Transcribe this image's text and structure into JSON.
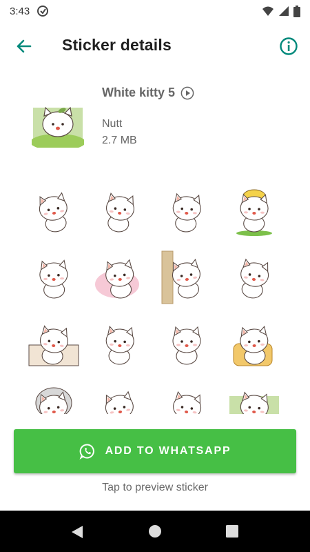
{
  "status_bar": {
    "time": "3:43",
    "icons": [
      "sync-icon",
      "wifi-icon",
      "signal-icon",
      "battery-icon"
    ]
  },
  "app_bar": {
    "title": "Sticker details",
    "back_icon": "arrow-left-icon",
    "info_icon": "info-icon"
  },
  "pack": {
    "name": "White kitty 5",
    "author": "Nutt",
    "size": "2.7 MB"
  },
  "stickers": [
    "sticker-cat-cheering",
    "sticker-cat-surprised",
    "sticker-cat-eating",
    "sticker-cat-yellow-hat",
    "sticker-cat-drinking",
    "sticker-cat-popcorn",
    "sticker-cat-peeking-wall",
    "sticker-cat-shy",
    "sticker-cat-box",
    "sticker-cat-pleading",
    "sticker-cat-sleepy",
    "sticker-cat-armchair",
    "sticker-cat-hood",
    "sticker-cat-lying",
    "sticker-cat-sitting",
    "sticker-cat-grass"
  ],
  "actions": {
    "add_button_label": "ADD TO WHATSAPP",
    "hint": "Tap to preview sticker"
  },
  "colors": {
    "accent": "#00897b",
    "button": "#46bf45",
    "text_primary": "#1f1f1f",
    "text_secondary": "#666666"
  }
}
